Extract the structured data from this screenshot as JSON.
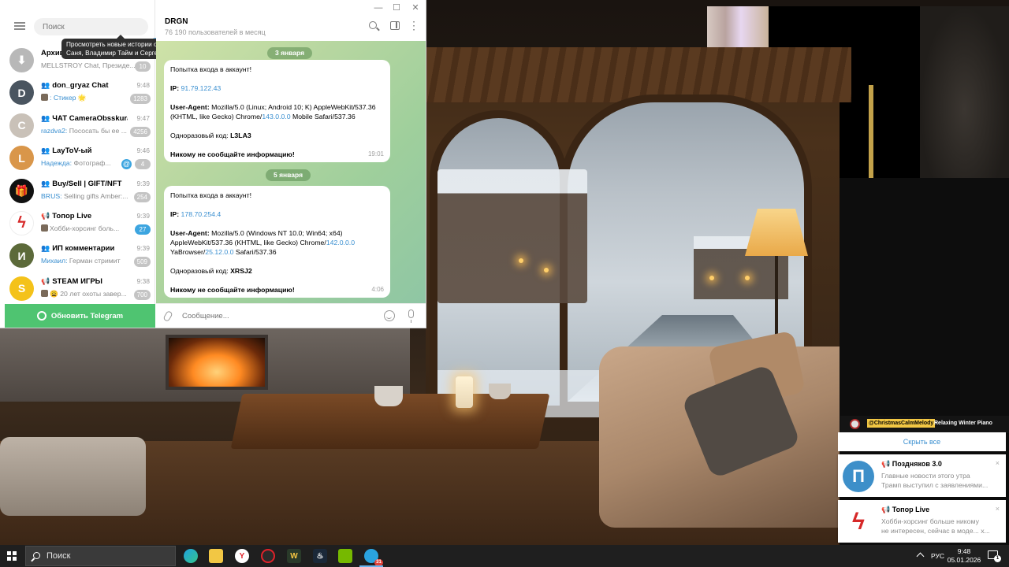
{
  "telegram": {
    "search_placeholder": "Поиск",
    "stories_tooltip": "Просмотреть новые истории от Саня, Владимир Тайм и Сергей.",
    "tooltip_close": "×",
    "chats": [
      {
        "title": "Архив",
        "preview": "MELLSTROY Chat, Президе...",
        "time": "",
        "badge": "10",
        "badge_color": "gray",
        "avatar_color": "#b8b8b8",
        "avatar_text": "⬇",
        "group": false
      },
      {
        "title": "don_gryaz Chat",
        "sender": "",
        "preview": ": Стикер 🌟",
        "time": "9:48",
        "badge": "1283",
        "badge_color": "gray",
        "avatar_color": "#4a5560",
        "avatar_text": "D",
        "group": true
      },
      {
        "title": "ЧАТ CameraObsskura",
        "sender": "razdva2:",
        "preview": " Пососать бы ее ...",
        "time": "9:47",
        "badge": "4256",
        "badge_color": "gray",
        "avatar_color": "#c9c1b8",
        "avatar_text": "C",
        "group": true
      },
      {
        "title": "LayToV-ый",
        "sender": "Надежда:",
        "preview": " Фотограф...",
        "time": "9:46",
        "badge": "4",
        "badge_color": "gray",
        "mention": "@",
        "avatar_color": "#d9964a",
        "avatar_text": "L",
        "group": true
      },
      {
        "title": "Buy/Sell | GIFT/NFT",
        "sender": "BRUS:",
        "preview": " Selling gifts  Amber:...",
        "time": "9:39",
        "badge": "254",
        "badge_color": "gray",
        "avatar_color": "#111111",
        "avatar_text": "🎁",
        "group": true
      },
      {
        "title": "Топор Live",
        "sender": "",
        "preview": "Хобби-хорсинг боль...",
        "time": "9:39",
        "badge": "27",
        "badge_color": "blue",
        "avatar_color": "#ffffff",
        "avatar_text": "ϟ",
        "group": false,
        "channel": true
      },
      {
        "title": "ИП комментарии",
        "sender": "Михаил:",
        "preview": " Герман стримит",
        "time": "9:39",
        "badge": "509",
        "badge_color": "gray",
        "avatar_color": "#5c6a3a",
        "avatar_text": "И",
        "group": true
      },
      {
        "title": "STEAM ИГРЫ",
        "sender": "",
        "preview": "😩 20 лет охоты завер...",
        "time": "9:38",
        "badge": "700",
        "badge_color": "gray",
        "avatar_color": "#f4c21a",
        "avatar_text": "S",
        "group": false,
        "channel": true
      }
    ],
    "update_button": "Обновить Telegram",
    "active_chat": {
      "name": "DRGN",
      "subtitle": "76 190 пользователей в месяц"
    },
    "messages": [
      {
        "date": "3 января",
        "heading": "Попытка входа в аккаунт!",
        "ip_label": "IP:",
        "ip": "91.79.122.43",
        "ua_label": "User-Agent:",
        "ua_part1": " Mozilla/5.0 (Linux; Android 10; K) AppleWebKit/537.36 (KHTML, like Gecko) Chrome/",
        "ua_link1": "143.0.0.0",
        "ua_part2": " Mobile Safari/537.36",
        "ua_link2": "",
        "ua_part3": "",
        "code_label": "Одноразовый код:",
        "code": "L3LA3",
        "warning": "Никому не сообщайте информацию!",
        "time": "19:01"
      },
      {
        "date": "5 января",
        "heading": "Попытка входа в аккаунт!",
        "ip_label": "IP:",
        "ip": "178.70.254.4",
        "ua_label": "User-Agent:",
        "ua_part1": " Mozilla/5.0 (Windows NT 10.0; Win64; x64) AppleWebKit/537.36 (KHTML, like Gecko) Chrome/",
        "ua_link1": "142.0.0.0",
        "ua_part2": " YaBrowser/",
        "ua_link2": "25.12.0.0",
        "ua_part3": " Safari/537.36",
        "code_label": "Одноразовый код:",
        "code": "XRSJ2",
        "warning": "Никому не сообщайте информацию!",
        "time": "4:06"
      }
    ],
    "composer_placeholder": "Сообщение..."
  },
  "overlay": {
    "stream_user": "@ChristmasCalmMelody",
    "stream_msg": "Relaxing Winter Piano",
    "hide_all": "Скрыть все",
    "notifications": [
      {
        "title": "Поздняков 3.0",
        "line1": "Главные новости этого утра",
        "line2": "Трамп выступил с заявлениями...",
        "avatar_color": "#3d8fc9",
        "avatar_text": "П"
      },
      {
        "title": "Топор Live",
        "line1": "Хобби-хорсинг больше никому",
        "line2": "не интересен, сейчас в моде...  x...",
        "avatar_color": "#ffffff",
        "avatar_text": "ϟ"
      }
    ],
    "close_glyph": "×"
  },
  "taskbar": {
    "search_label": "Поиск",
    "apps": [
      "edge",
      "explorer",
      "yandex",
      "opera",
      "warcraft",
      "steam",
      "nvidia",
      "telegram"
    ],
    "telegram_badge": "31",
    "lang": "РУС",
    "time": "9:48",
    "date": "05.01.2026",
    "notif_count": "1"
  },
  "colors": {
    "accent": "#3a8fd0",
    "update_green": "#4fc471",
    "chat_bg": "#b6d6a0"
  }
}
